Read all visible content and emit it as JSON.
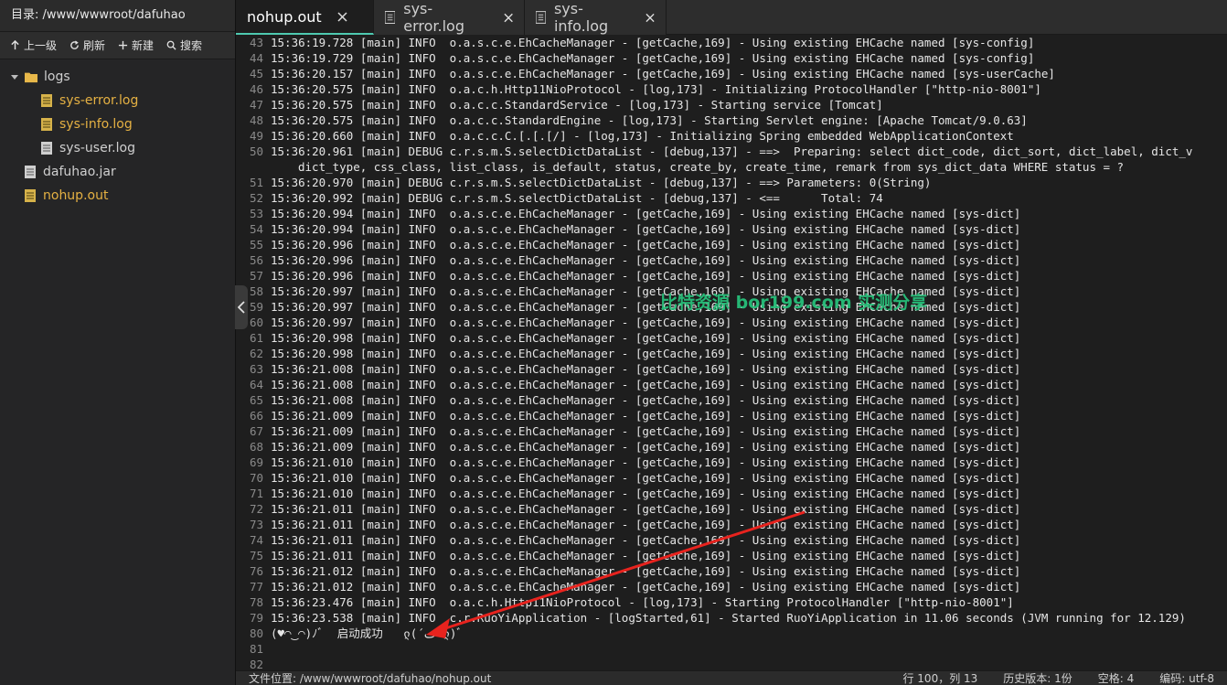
{
  "sidebar": {
    "dir_label": "目录: /www/wwwroot/dafuhao",
    "toolbar": {
      "up": "上一级",
      "refresh": "刷新",
      "new": "新建",
      "search": "搜索"
    },
    "tree": {
      "folder": "logs",
      "children": [
        "sys-error.log",
        "sys-info.log",
        "sys-user.log"
      ],
      "files": [
        "dafuhao.jar",
        "nohup.out"
      ]
    }
  },
  "tabs": [
    {
      "label": "nohup.out",
      "active": true
    },
    {
      "label": "sys-error.log",
      "active": false
    },
    {
      "label": "sys-info.log",
      "active": false
    }
  ],
  "editor": {
    "lines": [
      {
        "n": "43",
        "t": "15:36:19.728 [main] INFO  o.a.s.c.e.EhCacheManager - [getCache,169] - Using existing EHCache named [sys-config]"
      },
      {
        "n": "44",
        "t": "15:36:19.729 [main] INFO  o.a.s.c.e.EhCacheManager - [getCache,169] - Using existing EHCache named [sys-config]"
      },
      {
        "n": "45",
        "t": "15:36:20.157 [main] INFO  o.a.s.c.e.EhCacheManager - [getCache,169] - Using existing EHCache named [sys-userCache]"
      },
      {
        "n": "46",
        "t": "15:36:20.575 [main] INFO  o.a.c.h.Http11NioProtocol - [log,173] - Initializing ProtocolHandler [\"http-nio-8001\"]"
      },
      {
        "n": "47",
        "t": "15:36:20.575 [main] INFO  o.a.c.c.StandardService - [log,173] - Starting service [Tomcat]"
      },
      {
        "n": "48",
        "t": "15:36:20.575 [main] INFO  o.a.c.c.StandardEngine - [log,173] - Starting Servlet engine: [Apache Tomcat/9.0.63]"
      },
      {
        "n": "49",
        "t": "15:36:20.660 [main] INFO  o.a.c.c.C.[.[.[/] - [log,173] - Initializing Spring embedded WebApplicationContext"
      },
      {
        "n": "50",
        "t": "15:36:20.961 [main] DEBUG c.r.s.m.S.selectDictDataList - [debug,137] - ==>  Preparing: select dict_code, dict_sort, dict_label, dict_v"
      },
      {
        "n": "",
        "t": "dict_type, css_class, list_class, is_default, status, create_by, create_time, remark from sys_dict_data WHERE status = ?",
        "wrap": true
      },
      {
        "n": "51",
        "t": "15:36:20.970 [main] DEBUG c.r.s.m.S.selectDictDataList - [debug,137] - ==> Parameters: 0(String)"
      },
      {
        "n": "52",
        "t": "15:36:20.992 [main] DEBUG c.r.s.m.S.selectDictDataList - [debug,137] - <==      Total: 74"
      },
      {
        "n": "53",
        "t": "15:36:20.994 [main] INFO  o.a.s.c.e.EhCacheManager - [getCache,169] - Using existing EHCache named [sys-dict]"
      },
      {
        "n": "54",
        "t": "15:36:20.994 [main] INFO  o.a.s.c.e.EhCacheManager - [getCache,169] - Using existing EHCache named [sys-dict]"
      },
      {
        "n": "55",
        "t": "15:36:20.996 [main] INFO  o.a.s.c.e.EhCacheManager - [getCache,169] - Using existing EHCache named [sys-dict]"
      },
      {
        "n": "56",
        "t": "15:36:20.996 [main] INFO  o.a.s.c.e.EhCacheManager - [getCache,169] - Using existing EHCache named [sys-dict]"
      },
      {
        "n": "57",
        "t": "15:36:20.996 [main] INFO  o.a.s.c.e.EhCacheManager - [getCache,169] - Using existing EHCache named [sys-dict]"
      },
      {
        "n": "58",
        "t": "15:36:20.997 [main] INFO  o.a.s.c.e.EhCacheManager - [getCache,169] - Using existing EHCache named [sys-dict]"
      },
      {
        "n": "59",
        "t": "15:36:20.997 [main] INFO  o.a.s.c.e.EhCacheManager - [getCache,169] - Using existing EHCache named [sys-dict]"
      },
      {
        "n": "60",
        "t": "15:36:20.997 [main] INFO  o.a.s.c.e.EhCacheManager - [getCache,169] - Using existing EHCache named [sys-dict]"
      },
      {
        "n": "61",
        "t": "15:36:20.998 [main] INFO  o.a.s.c.e.EhCacheManager - [getCache,169] - Using existing EHCache named [sys-dict]"
      },
      {
        "n": "62",
        "t": "15:36:20.998 [main] INFO  o.a.s.c.e.EhCacheManager - [getCache,169] - Using existing EHCache named [sys-dict]"
      },
      {
        "n": "63",
        "t": "15:36:21.008 [main] INFO  o.a.s.c.e.EhCacheManager - [getCache,169] - Using existing EHCache named [sys-dict]"
      },
      {
        "n": "64",
        "t": "15:36:21.008 [main] INFO  o.a.s.c.e.EhCacheManager - [getCache,169] - Using existing EHCache named [sys-dict]"
      },
      {
        "n": "65",
        "t": "15:36:21.008 [main] INFO  o.a.s.c.e.EhCacheManager - [getCache,169] - Using existing EHCache named [sys-dict]"
      },
      {
        "n": "66",
        "t": "15:36:21.009 [main] INFO  o.a.s.c.e.EhCacheManager - [getCache,169] - Using existing EHCache named [sys-dict]"
      },
      {
        "n": "67",
        "t": "15:36:21.009 [main] INFO  o.a.s.c.e.EhCacheManager - [getCache,169] - Using existing EHCache named [sys-dict]"
      },
      {
        "n": "68",
        "t": "15:36:21.009 [main] INFO  o.a.s.c.e.EhCacheManager - [getCache,169] - Using existing EHCache named [sys-dict]"
      },
      {
        "n": "69",
        "t": "15:36:21.010 [main] INFO  o.a.s.c.e.EhCacheManager - [getCache,169] - Using existing EHCache named [sys-dict]"
      },
      {
        "n": "70",
        "t": "15:36:21.010 [main] INFO  o.a.s.c.e.EhCacheManager - [getCache,169] - Using existing EHCache named [sys-dict]"
      },
      {
        "n": "71",
        "t": "15:36:21.010 [main] INFO  o.a.s.c.e.EhCacheManager - [getCache,169] - Using existing EHCache named [sys-dict]"
      },
      {
        "n": "72",
        "t": "15:36:21.011 [main] INFO  o.a.s.c.e.EhCacheManager - [getCache,169] - Using existing EHCache named [sys-dict]"
      },
      {
        "n": "73",
        "t": "15:36:21.011 [main] INFO  o.a.s.c.e.EhCacheManager - [getCache,169] - Using existing EHCache named [sys-dict]"
      },
      {
        "n": "74",
        "t": "15:36:21.011 [main] INFO  o.a.s.c.e.EhCacheManager - [getCache,169] - Using existing EHCache named [sys-dict]"
      },
      {
        "n": "75",
        "t": "15:36:21.011 [main] INFO  o.a.s.c.e.EhCacheManager - [getCache,169] - Using existing EHCache named [sys-dict]"
      },
      {
        "n": "76",
        "t": "15:36:21.012 [main] INFO  o.a.s.c.e.EhCacheManager - [getCache,169] - Using existing EHCache named [sys-dict]"
      },
      {
        "n": "77",
        "t": "15:36:21.012 [main] INFO  o.a.s.c.e.EhCacheManager - [getCache,169] - Using existing EHCache named [sys-dict]"
      },
      {
        "n": "78",
        "t": "15:36:23.476 [main] INFO  o.a.c.h.Http11NioProtocol - [log,173] - Starting ProtocolHandler [\"http-nio-8001\"]"
      },
      {
        "n": "79",
        "t": "15:36:23.538 [main] INFO  c.r.RuoYiApplication - [logStarted,61] - Started RuoYiApplication in 11.06 seconds (JVM running for 12.129)"
      },
      {
        "n": "80",
        "t": "(♥◠‿◠)ﾉﾞ  启动成功   ლ(´ڡ`ლ)ﾞ  "
      },
      {
        "n": "81",
        "t": ""
      },
      {
        "n": "82",
        "t": ""
      }
    ]
  },
  "watermark": "比特资源 bor199.com 实测分享",
  "statusbar": {
    "path": "文件位置: /www/wwwroot/dafuhao/nohup.out",
    "cursor": "行 100，列 13",
    "history": "历史版本: 1份",
    "indent": "空格: 4",
    "encoding": "编码: utf-8"
  },
  "colors": {
    "accent_tab": "#4ec9b0",
    "highlight_file": "#e5b143",
    "watermark": "#27c07a",
    "arrow": "#e8231e"
  }
}
